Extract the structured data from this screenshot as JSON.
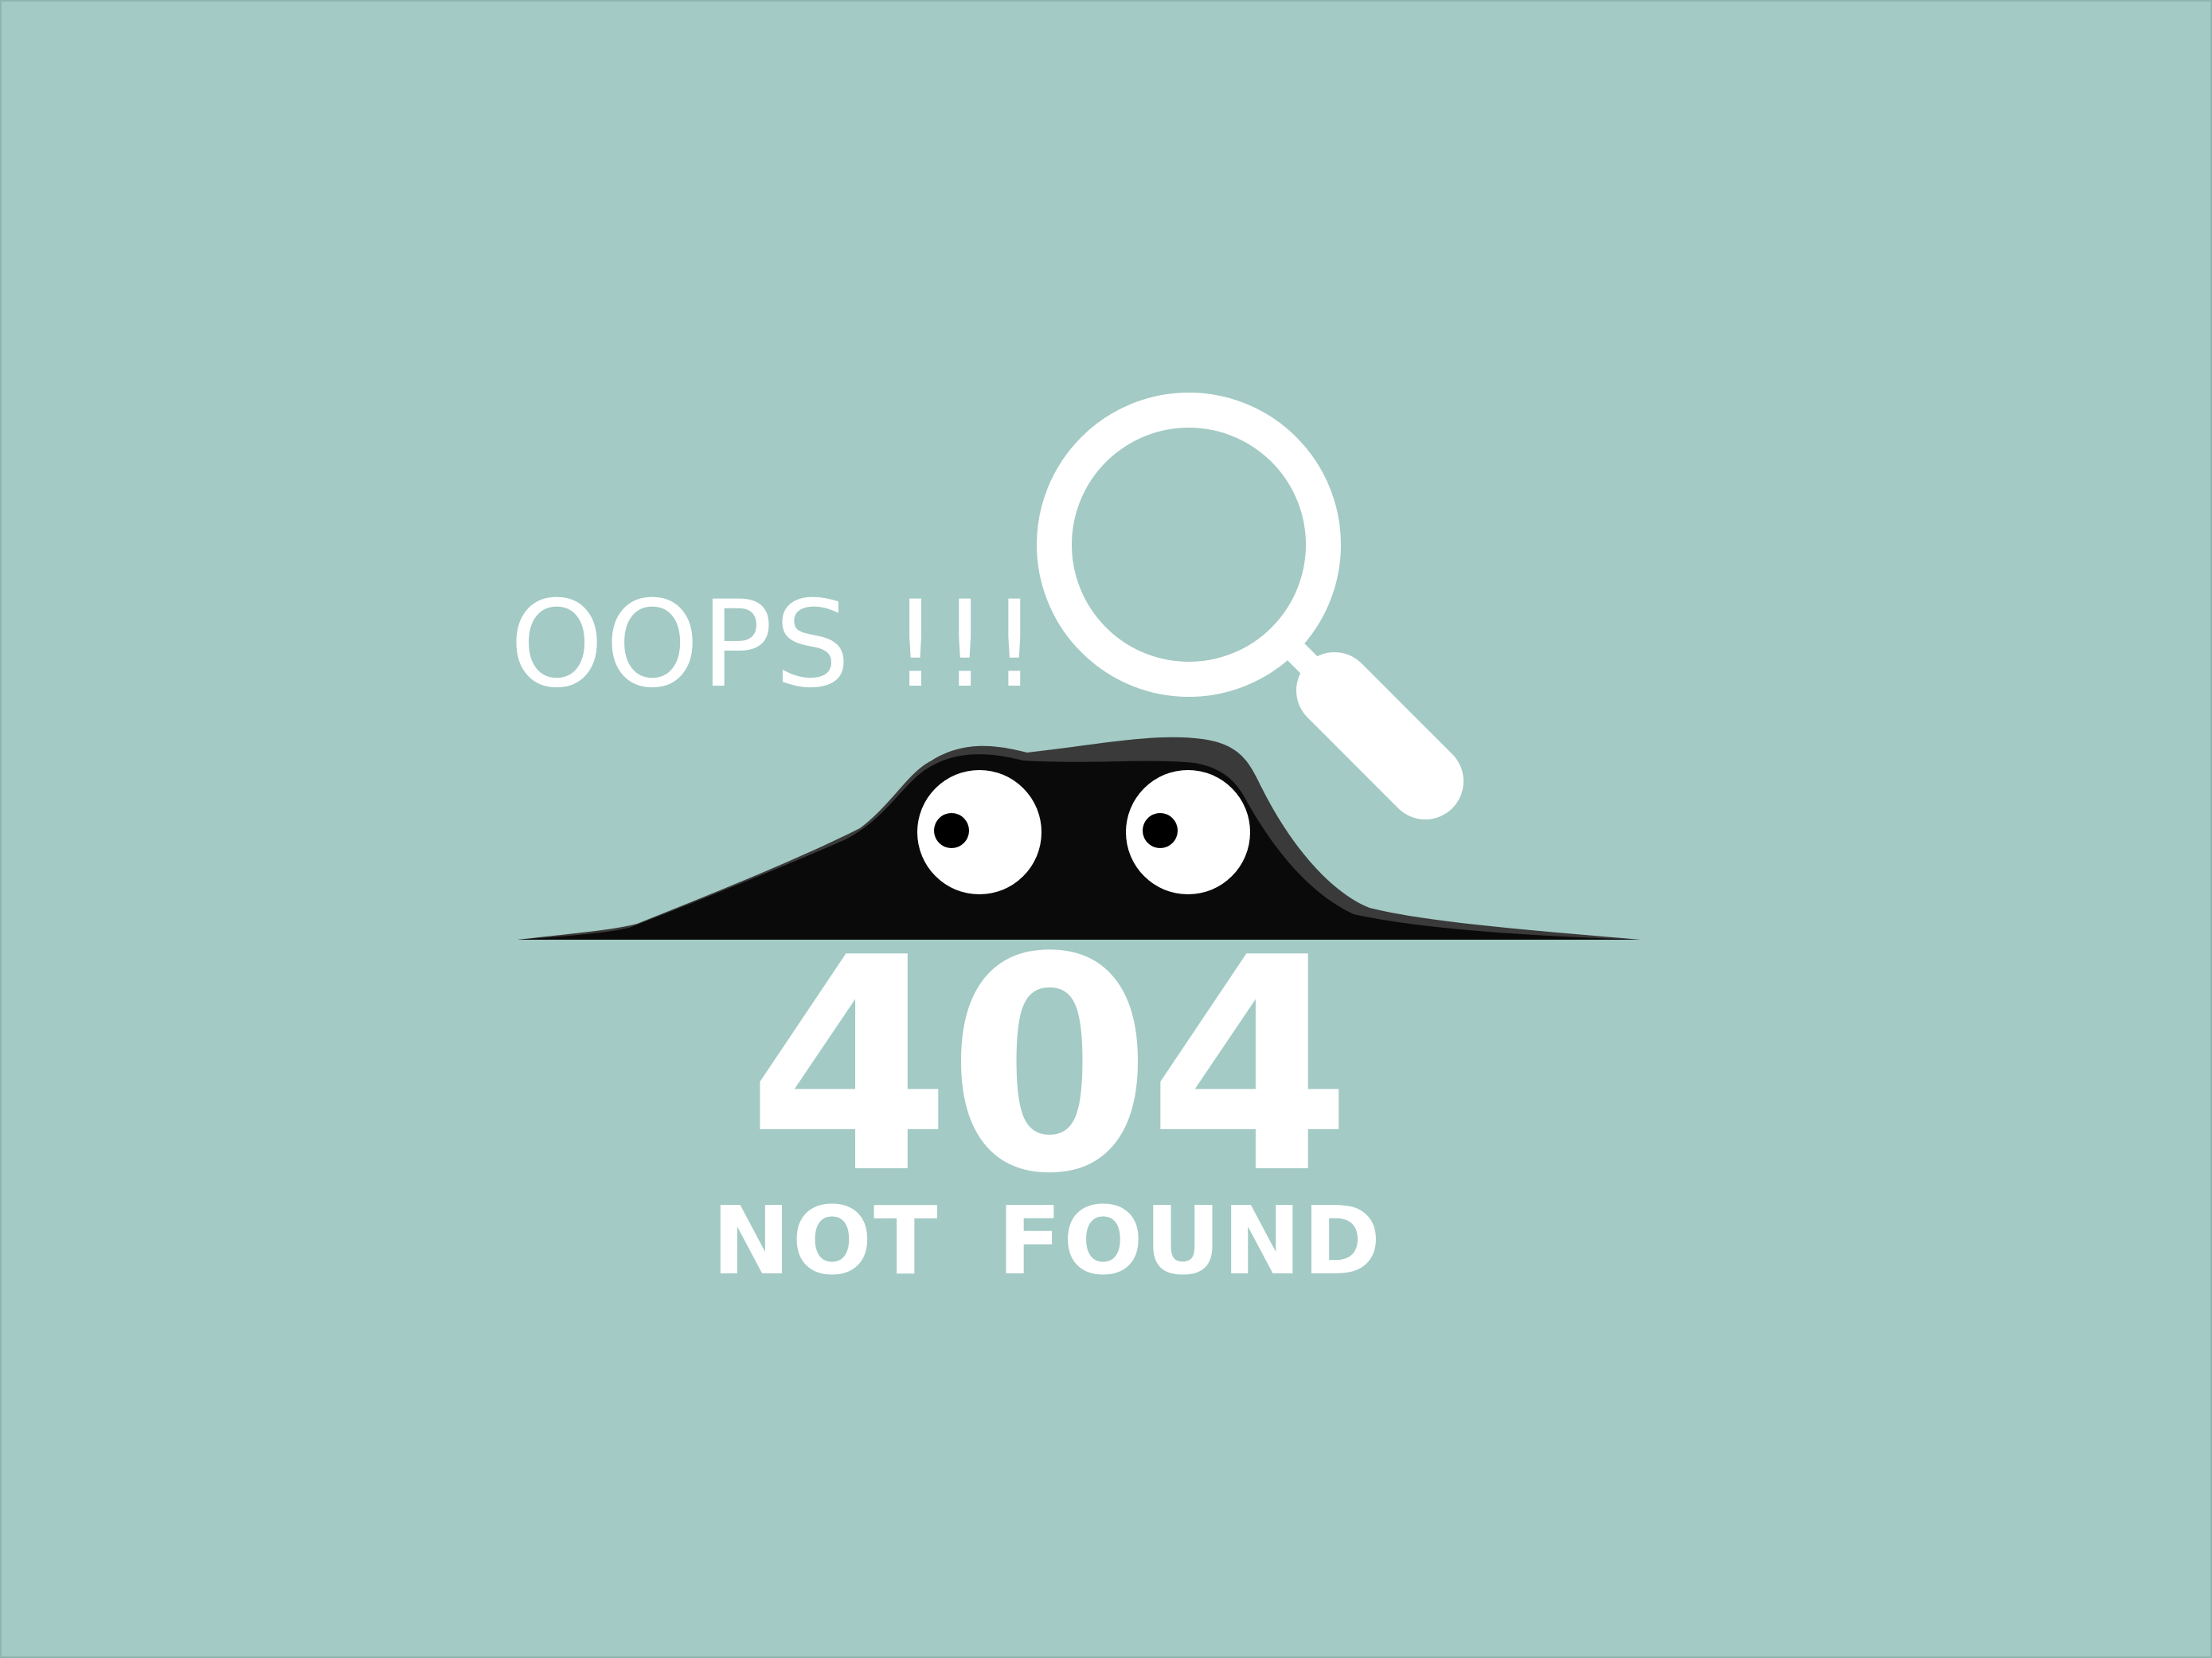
{
  "page": {
    "exclamation": "OOPS !!!",
    "error_code": "404",
    "error_message": "NOT FOUND"
  },
  "icons": [
    "magnifying-glass-icon",
    "peeking-creature-illustration"
  ],
  "colors": {
    "background": "#a3cac4",
    "text": "#ffffff",
    "creature": "#0a0a0a",
    "creature_highlight": "#3a3a3a",
    "eye_white": "#ffffff",
    "pupil": "#000000"
  }
}
